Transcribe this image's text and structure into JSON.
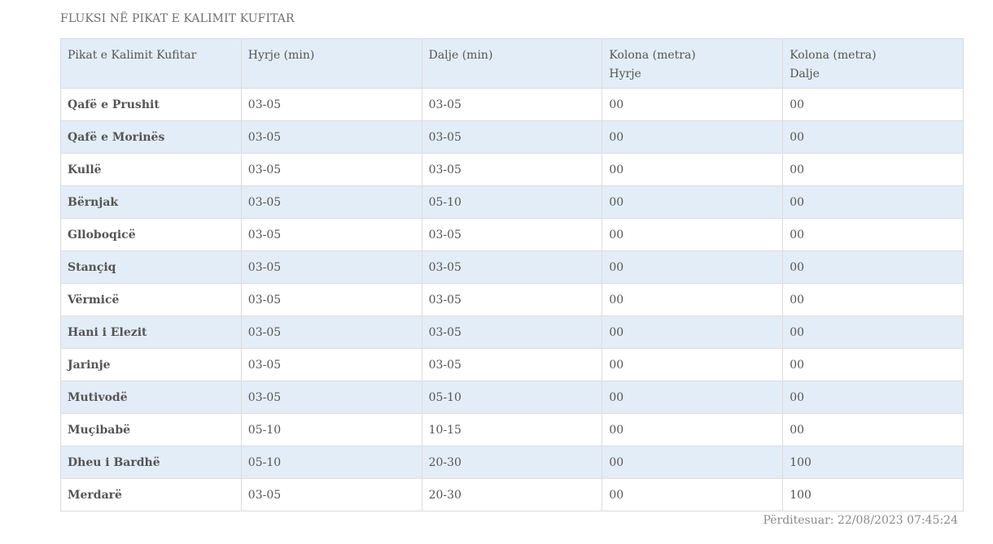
{
  "section_title": "FLUKSI NË PIKAT E KALIMIT KUFITAR",
  "table": {
    "headers": [
      [
        "Pikat e Kalimit Kufitar"
      ],
      [
        "Hyrje (min)"
      ],
      [
        "Dalje (min)"
      ],
      [
        "Kolona (metra)",
        "Hyrje"
      ],
      [
        "Kolona (metra)",
        "Dalje"
      ]
    ],
    "rows": [
      [
        "Qafë e Prushit",
        "03-05",
        "03-05",
        "00",
        "00"
      ],
      [
        "Qafë e Morinës",
        "03-05",
        "03-05",
        "00",
        "00"
      ],
      [
        "Kullë",
        "03-05",
        "03-05",
        "00",
        "00"
      ],
      [
        "Bërnjak",
        "03-05",
        "05-10",
        "00",
        "00"
      ],
      [
        "Glloboqicë",
        "03-05",
        "03-05",
        "00",
        "00"
      ],
      [
        "Stançiq",
        "03-05",
        "03-05",
        "00",
        "00"
      ],
      [
        "Vërmicë",
        "03-05",
        "03-05",
        "00",
        "00"
      ],
      [
        "Hani i Elezit",
        "03-05",
        "03-05",
        "00",
        "00"
      ],
      [
        "Jarinje",
        "03-05",
        "03-05",
        "00",
        "00"
      ],
      [
        "Mutivodë",
        "03-05",
        "05-10",
        "00",
        "00"
      ],
      [
        "Muçibabë",
        "05-10",
        "10-15",
        "00",
        "00"
      ],
      [
        "Dheu i Bardhë",
        "05-10",
        "20-30",
        "00",
        "100"
      ],
      [
        "Merdarë",
        "03-05",
        "20-30",
        "00",
        "100"
      ]
    ]
  },
  "footer": {
    "updated_label": "Përditesuar:",
    "updated_value": "22/08/2023 07:45:24"
  },
  "colors": {
    "header_bg": "#e3edf7",
    "stripe_bg": "#e3edf7",
    "border": "#dcdcdc",
    "text": "#555555"
  }
}
